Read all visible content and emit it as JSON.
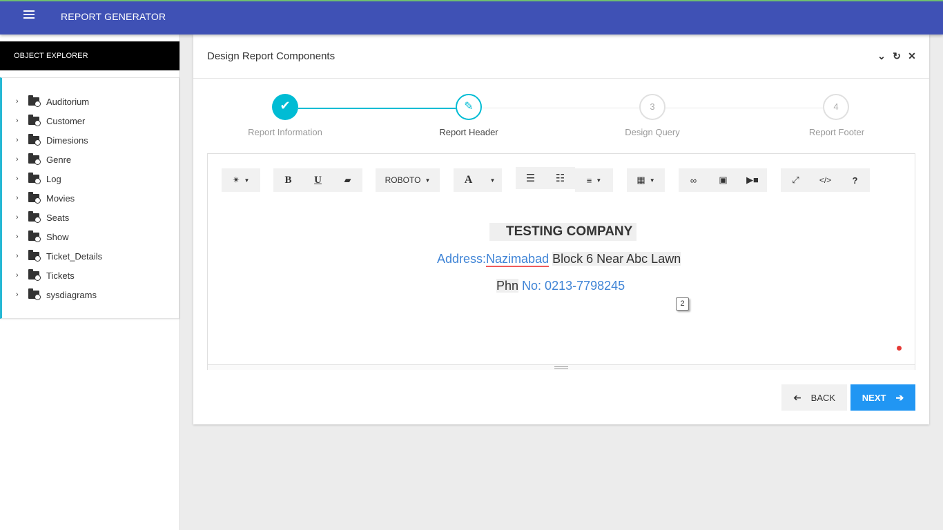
{
  "app": {
    "title": "REPORT GENERATOR"
  },
  "sidebar": {
    "header": "OBJECT EXPLORER",
    "items": [
      "Auditorium",
      "Customer",
      "Dimesions",
      "Genre",
      "Log",
      "Movies",
      "Seats",
      "Show",
      "Ticket_Details",
      "Tickets",
      "sysdiagrams"
    ]
  },
  "card": {
    "title": "Design Report Components",
    "tools": [
      "chevron-down-icon",
      "refresh-icon",
      "close-icon"
    ]
  },
  "stepper": {
    "steps": [
      {
        "label": "Report Information",
        "number": "",
        "state": "done"
      },
      {
        "label": "Report Header",
        "number": "",
        "state": "active"
      },
      {
        "label": "Design Query",
        "number": "3",
        "state": "todo"
      },
      {
        "label": "Report Footer",
        "number": "4",
        "state": "todo"
      }
    ],
    "accent": "#00bcd4"
  },
  "toolbar": {
    "font_name": "ROBOTO",
    "bold": "B",
    "underline": "U",
    "font_color": "A",
    "code": "</>",
    "help": "?"
  },
  "content": {
    "company": "TESTING COMPANY",
    "address_label": "Address:",
    "address_value": "Nazimabad",
    "address_rest": "Block 6 Near Abc Lawn",
    "phone_prefix": "Phn",
    "phone_rest": "No: 0213-7798245",
    "page_badge": "2"
  },
  "buttons": {
    "back": "BACK",
    "next": "NEXT"
  }
}
